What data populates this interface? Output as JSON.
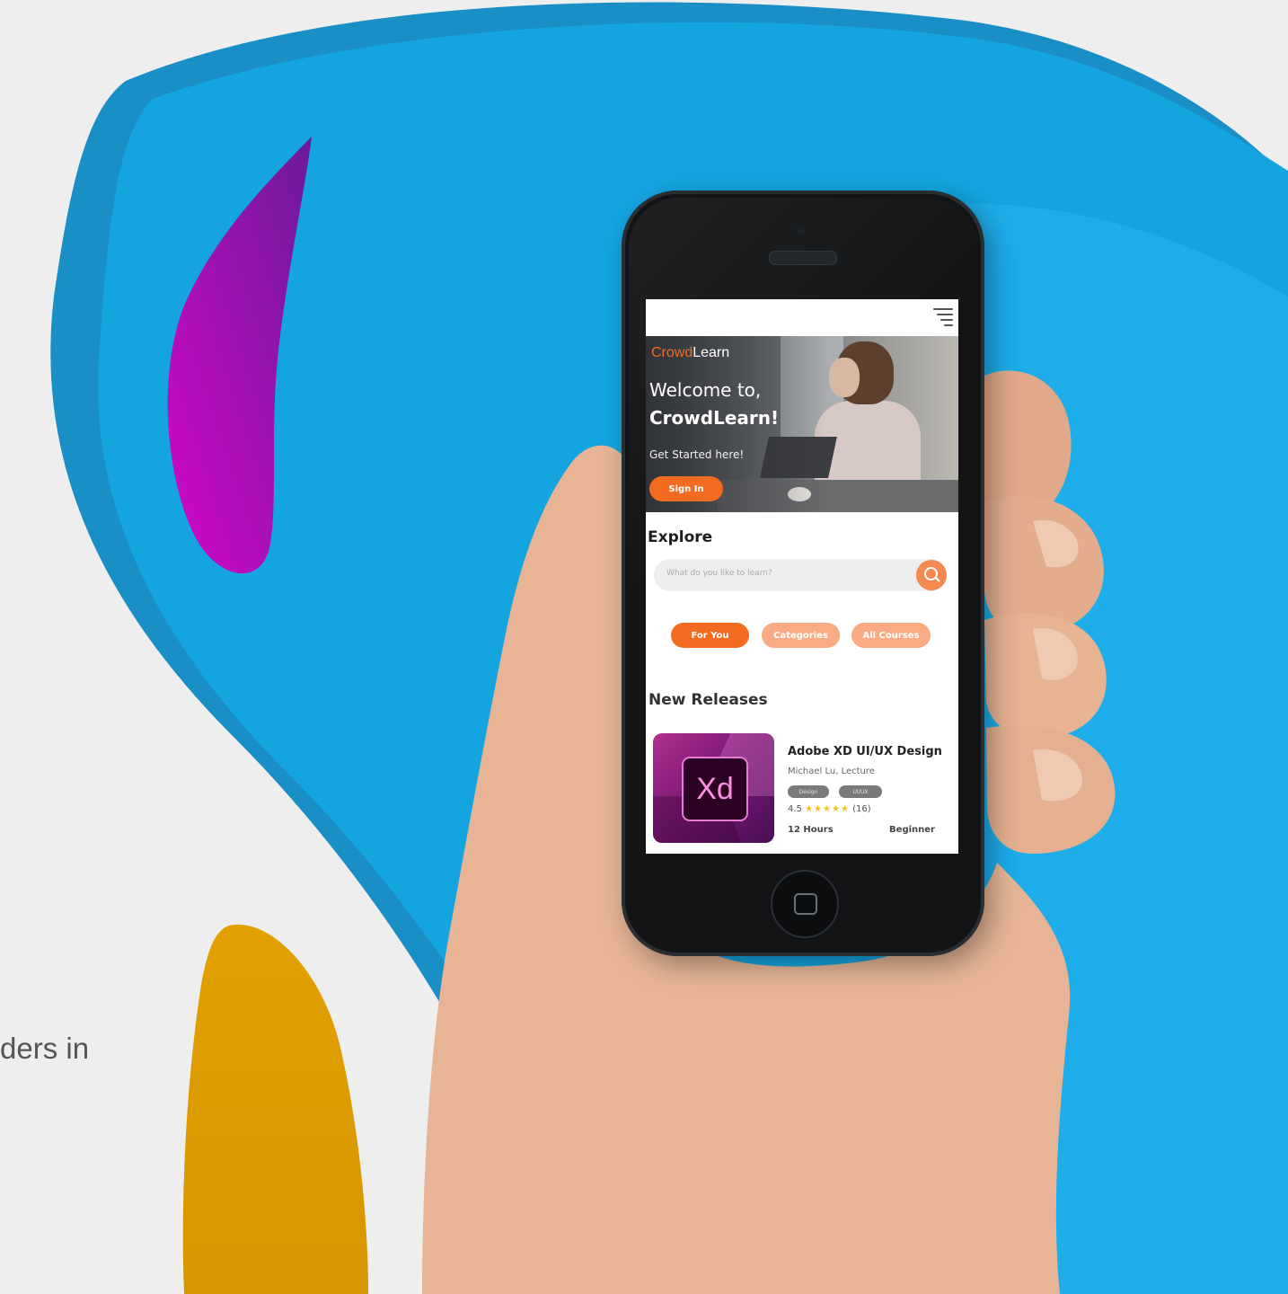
{
  "background_fragment_text": "ders in",
  "app": {
    "brand_part1": "Crowd",
    "brand_part2": "Learn",
    "hero": {
      "welcome_line1": "Welcome to,",
      "welcome_line2": "CrowdLearn!",
      "subtitle": "Get Started here!",
      "signin_label": "Sign In"
    },
    "explore": {
      "heading": "Explore",
      "search_placeholder": "What do you like to learn?",
      "tabs": [
        "For You",
        "Categories",
        "All Courses"
      ],
      "active_tab": "For You"
    },
    "new_releases": {
      "heading": "New Releases",
      "course": {
        "thumbnail_text": "Xd",
        "title": "Adobe XD UI/UX Design",
        "author": "Michael Lu, Lecture",
        "tags": [
          "Design",
          "UI/UX"
        ],
        "rating": "4.5",
        "stars": "★★★★★",
        "reviews": "(16)",
        "duration": "12 Hours",
        "level": "Beginner"
      }
    }
  },
  "colors": {
    "accent": "#f36b21",
    "accent_light": "#f9ab84",
    "background_blue": "#14a5e0",
    "phone_body": "#121416"
  },
  "icons": [
    "menu-icon",
    "search-icon",
    "home-button-icon"
  ]
}
